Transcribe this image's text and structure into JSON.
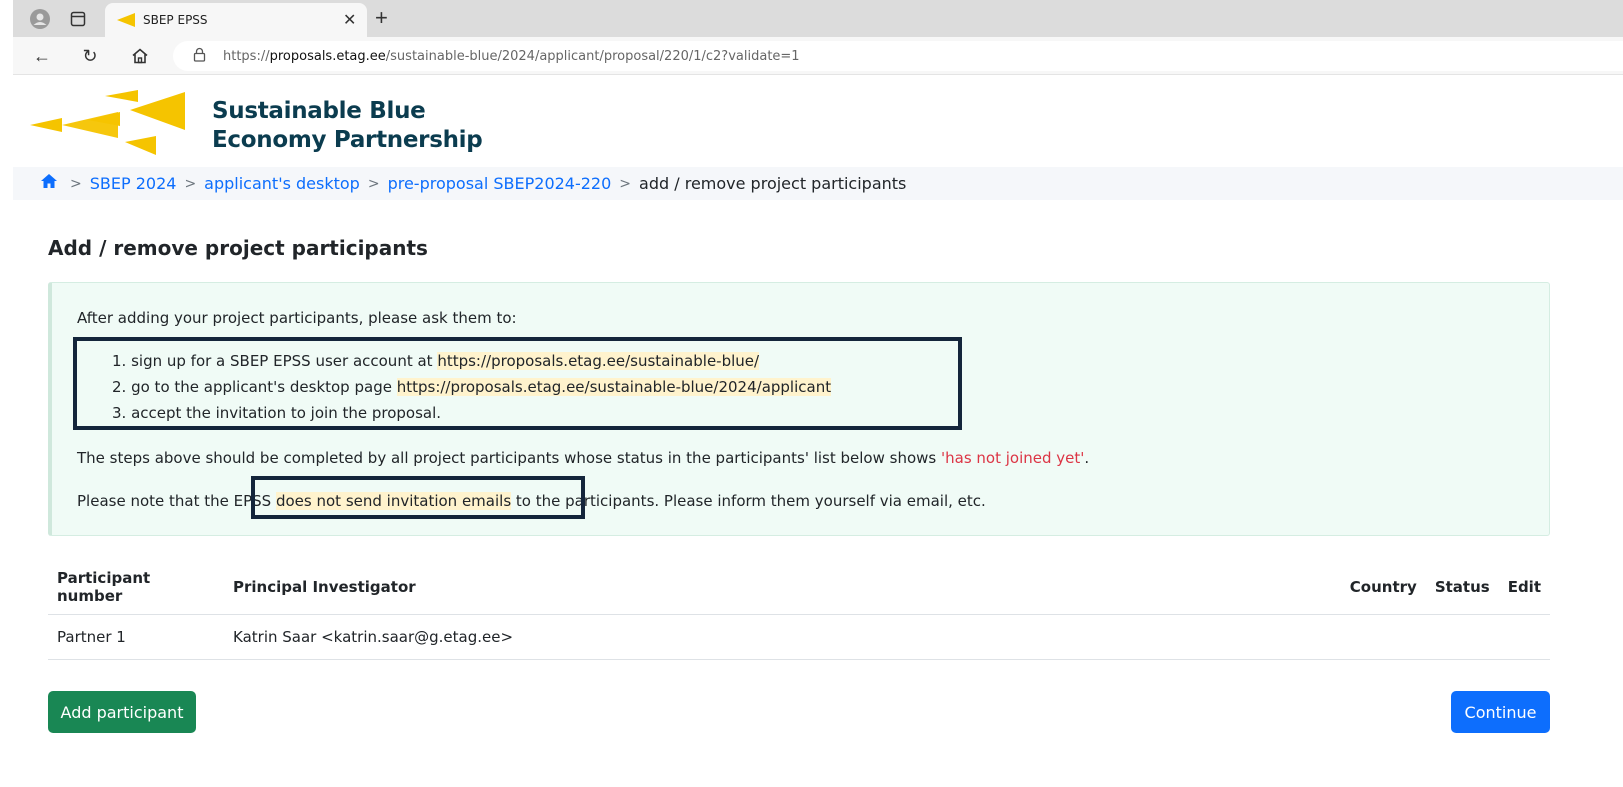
{
  "browser": {
    "tab_title": "SBEP EPSS",
    "url_prefix": "https://",
    "url_host": "proposals.etag.ee",
    "url_path": "/sustainable-blue/2024/applicant/proposal/220/1/c2?validate=1"
  },
  "site": {
    "brand_line1": "Sustainable Blue",
    "brand_line2": "Economy Partnership",
    "logo_color": "#f5c400",
    "brand_color": "#0b3c4f"
  },
  "breadcrumb": {
    "items": [
      "SBEP 2024",
      "applicant's desktop",
      "pre-proposal SBEP2024-220"
    ],
    "current": "add / remove project participants",
    "separator": ">"
  },
  "page": {
    "title": "Add / remove project participants"
  },
  "info": {
    "intro": "After adding your project participants, please ask them to:",
    "steps": [
      {
        "num": "1.",
        "text": "sign up for a SBEP EPSS user account at ",
        "link": "https://proposals.etag.ee/sustainable-blue/"
      },
      {
        "num": "2.",
        "text": "go to the applicant's desktop page ",
        "link": "https://proposals.etag.ee/sustainable-blue/2024/applicant"
      },
      {
        "num": "3.",
        "text": "accept the invitation to join the proposal.",
        "link": ""
      }
    ],
    "status_pre": "The steps above should be completed by all project participants whose status in the participants' list below shows ",
    "status_value": "'has not joined yet'",
    "status_post": ".",
    "note_pre": "Please note that the EPSS ",
    "note_highlight": "does not send invitation emails",
    "note_post": " to the participants. Please inform them yourself via email, etc."
  },
  "table": {
    "headers": {
      "number": "Participant number",
      "pi": "Principal Investigator",
      "country": "Country",
      "status": "Status",
      "edit": "Edit"
    },
    "rows": [
      {
        "number": "Partner 1",
        "pi": "Katrin Saar <katrin.saar@g.etag.ee>",
        "country": "",
        "status": "",
        "edit": ""
      }
    ]
  },
  "buttons": {
    "add": "Add participant",
    "continue": "Continue"
  },
  "colors": {
    "add_button": "#198754",
    "continue_button": "#0d6efd",
    "link": "#0d6efd",
    "info_bg": "#f0fbf6"
  }
}
